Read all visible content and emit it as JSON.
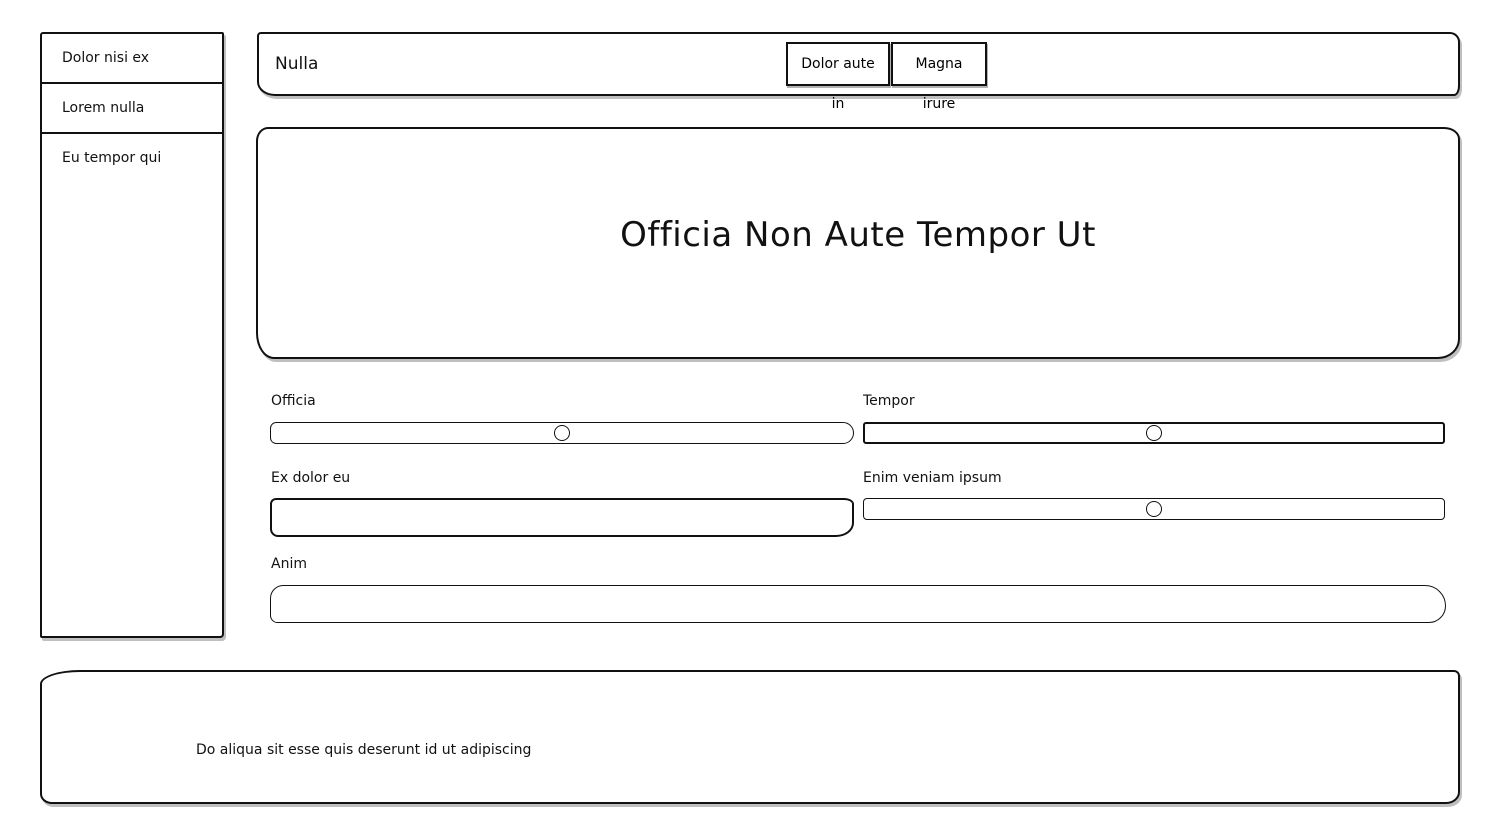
{
  "sidebar": {
    "items": [
      {
        "label": "Dolor nisi ex"
      },
      {
        "label": "Lorem nulla"
      },
      {
        "label": "Eu tempor qui"
      }
    ]
  },
  "topbar": {
    "title": "Nulla",
    "buttons": [
      {
        "label": "Dolor aute in"
      },
      {
        "label": "Magna irure"
      }
    ]
  },
  "hero": {
    "title": "Officia Non Aute Tempor Ut"
  },
  "form": {
    "officia": {
      "label": "Officia",
      "value_fraction": 0.5
    },
    "tempor": {
      "label": "Tempor",
      "value_fraction": 0.5
    },
    "ex_dolor_eu": {
      "label": "Ex dolor eu",
      "value": ""
    },
    "enim_veniam_ipsum": {
      "label": "Enim veniam ipsum",
      "value_fraction": 0.5
    },
    "anim": {
      "label": "Anim",
      "value": ""
    }
  },
  "footer": {
    "text": "Do aliqua sit esse quis deserunt id ut adipiscing"
  }
}
